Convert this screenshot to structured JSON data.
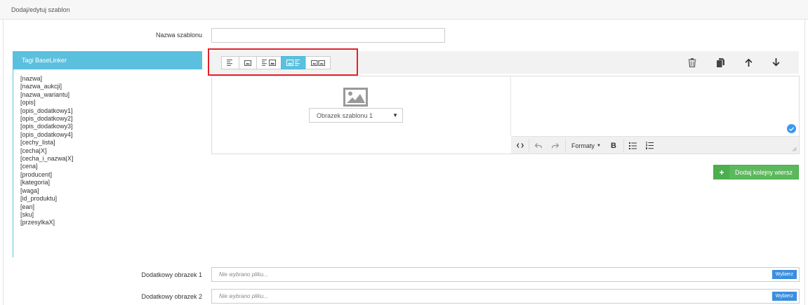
{
  "header": {
    "title": "Dodaj/edytuj szablon"
  },
  "form": {
    "name_label": "Nazwa szablonu",
    "name_value": "",
    "extra_image_1_label": "Dodatkowy obrazek 1",
    "extra_image_2_label": "Dodatkowy obrazek 2",
    "file_placeholder": "Nie wybrano pliku...",
    "choose_label": "Wybierz"
  },
  "tags": {
    "title": "Tagi BaseLinker",
    "items": [
      "[nazwa]",
      "[nazwa_aukcji]",
      "[nazwa_wariantu]",
      "[opis]",
      "[opis_dodatkowy1]",
      "[opis_dodatkowy2]",
      "[opis_dodatkowy3]",
      "[opis_dodatkowy4]",
      "[cechy_lista]",
      "[cecha|X]",
      "[cecha_i_nazwa|X]",
      "[cena]",
      "[producent]",
      "[kategoria]",
      "[waga]",
      "[id_produktu]",
      "[ean]",
      "[sku]",
      "[przesylkaX]"
    ]
  },
  "layout_buttons": [
    {
      "icon": "text-only-layout-icon",
      "active": false
    },
    {
      "icon": "image-only-layout-icon",
      "active": false
    },
    {
      "icon": "text-image-layout-icon",
      "active": false
    },
    {
      "icon": "image-text-layout-icon",
      "active": true
    },
    {
      "icon": "two-images-layout-icon",
      "active": false
    }
  ],
  "row_tools": [
    "trash-icon",
    "copy-icon",
    "arrow-up-icon",
    "arrow-down-icon"
  ],
  "image_block": {
    "icon": "image-placeholder-icon",
    "select_value": "Obrazek szablonu 1"
  },
  "text_editor": {
    "formats_label": "Formaty",
    "bold_label": "B"
  },
  "add_row_label": "Dodaj kolejny wiersz",
  "colors": {
    "accent": "#5bc0de",
    "success": "#5cb85c",
    "highlight": "#e2222a",
    "primary": "#3b8ede"
  }
}
